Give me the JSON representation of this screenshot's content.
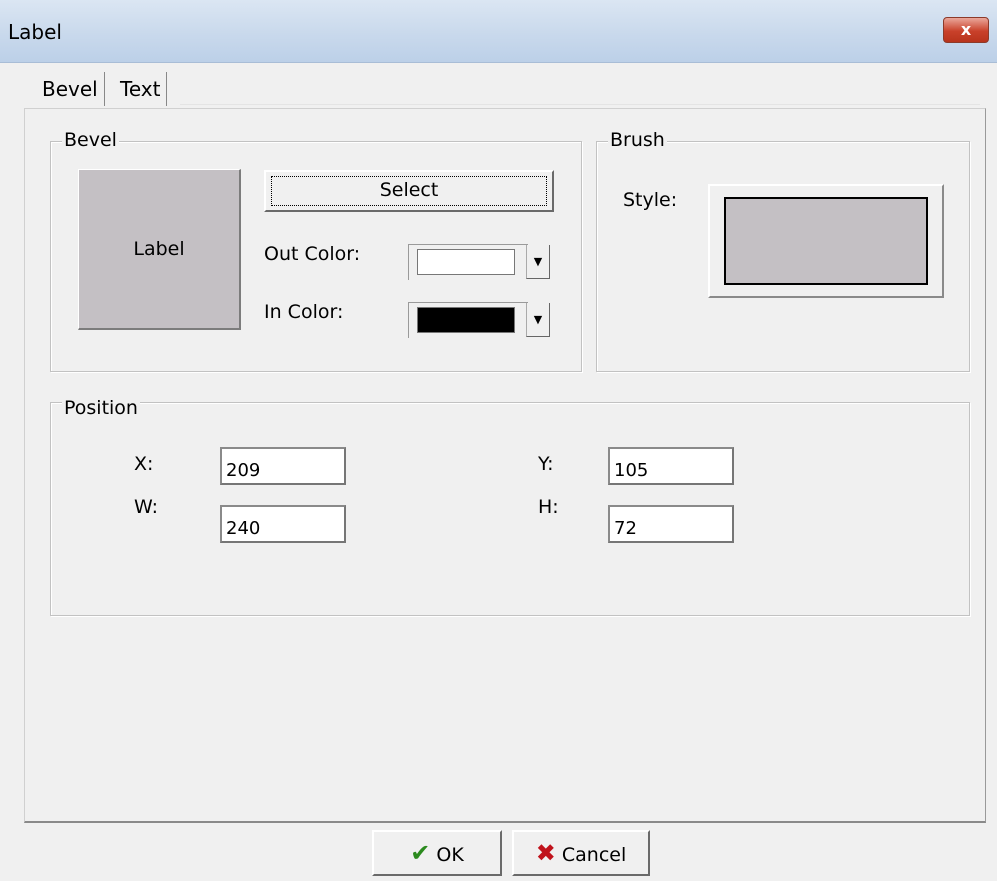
{
  "window": {
    "title": "Label",
    "close_glyph": "x"
  },
  "tabs": [
    {
      "label": "Bevel"
    },
    {
      "label": "Text"
    }
  ],
  "bevel": {
    "legend": "Bevel",
    "preview_label": "Label",
    "select_label": "Select",
    "out_color_label": "Out Color:",
    "out_color_value": "#ffffff",
    "in_color_label": "In Color:",
    "in_color_value": "#000000"
  },
  "brush": {
    "legend": "Brush",
    "style_label": "Style:",
    "style_color": "#c4c0c4"
  },
  "position": {
    "legend": "Position",
    "x_label": "X:",
    "x_value": "209",
    "y_label": "Y:",
    "y_value": "105",
    "w_label": "W:",
    "w_value": "240",
    "h_label": "H:",
    "h_value": "72"
  },
  "footer": {
    "ok_label": "OK",
    "cancel_label": "Cancel"
  },
  "icons": {
    "ok": "checkmark-icon",
    "cancel": "x-mark-icon",
    "dropdown": "chevron-down-icon"
  }
}
